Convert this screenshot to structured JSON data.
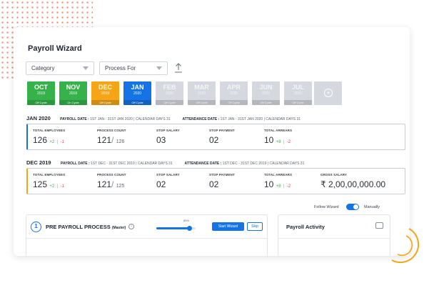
{
  "title": "Payroll Wizard",
  "filters": {
    "category": "Category",
    "process_for": "Process For"
  },
  "months": [
    {
      "name": "OCT",
      "year": "2019",
      "tag": "Off Cycle",
      "state": "green"
    },
    {
      "name": "NOV",
      "year": "2019",
      "tag": "On Cycle",
      "state": "green"
    },
    {
      "name": "DEC",
      "year": "2019",
      "tag": "Off Cycle",
      "state": "orange"
    },
    {
      "name": "JAN",
      "year": "2020",
      "tag": "Off Cycle",
      "state": "blue"
    },
    {
      "name": "FEB",
      "year": "2020",
      "tag": "Off Cycle",
      "state": "grey"
    },
    {
      "name": "MAR",
      "year": "2020",
      "tag": "Off Cycle",
      "state": "grey"
    },
    {
      "name": "APR",
      "year": "2020",
      "tag": "Off Cycle",
      "state": "grey"
    },
    {
      "name": "JUN",
      "year": "2020",
      "tag": "Off Cycle",
      "state": "grey"
    },
    {
      "name": "JUL",
      "year": "2020",
      "tag": "Off Cycle",
      "state": "grey"
    }
  ],
  "colors": {
    "green": "#36b24a",
    "orange": "#f5a516",
    "blue": "#1473e6",
    "grey": "#d5d8de"
  },
  "jan": {
    "month": "JAN 2020",
    "payroll_label": "PAYROLL DATE :",
    "payroll_value": "1ST JAN - 31ST JAN 2020 | CALENDAR DAYS 31",
    "attendance_label": "ATTENDANCE DATE :",
    "attendance_value": "1ST JAN - 31ST JAN 2020 | CALENDAR DAYS 31",
    "total_employees_label": "TOTAL EMPLOYEES",
    "total_employees": "126",
    "total_employees_plus": "+2",
    "total_employees_minus": "-1",
    "process_count_label": "PROCESS COUNT",
    "process_count": "121",
    "process_count_total": "126",
    "stop_salary_label": "STOP SALARY",
    "stop_salary": "03",
    "stop_payment_label": "STOP PAYMENT",
    "stop_payment": "02",
    "total_arrears_label": "TOTAL ARREARS",
    "total_arrears": "10",
    "total_arrears_plus": "+8",
    "total_arrears_minus": "-2"
  },
  "dec": {
    "month": "DEC 2019",
    "payroll_label": "PAYROLL DATE :",
    "payroll_value": "1ST DEC - 31ST DEC 2019 | CALENDAR DAYS 31",
    "attendance_label": "ATTENDANCE DATE :",
    "attendance_value": "1ST DEC - 31ST DEC 2019 | CALENDAR DAYS 31",
    "total_employees_label": "TOTAL EMPLOYEES",
    "total_employees": "125",
    "total_employees_plus": "+2",
    "total_employees_minus": "-1",
    "process_count_label": "PROCESS COUNT",
    "process_count": "121",
    "process_count_total": "125",
    "stop_salary_label": "STOP SALARY",
    "stop_salary": "02",
    "stop_payment_label": "STOP PAYMENT",
    "stop_payment": "02",
    "total_arrears_label": "TOTAL ARREARS",
    "total_arrears": "10",
    "total_arrears_plus": "+8",
    "total_arrears_minus": "-2",
    "gross_salary_label": "GROSS SALARY",
    "gross_salary": "₹ 2,00,00,000.00"
  },
  "wizard": {
    "follow": "Follow Wizard",
    "manual": "Manually",
    "manual_on": true
  },
  "pre_payroll": {
    "step": "1",
    "title": "PRE PAYROLL PROCESS",
    "sub": "(Master)",
    "progress_text": "85%",
    "progress": 0.85,
    "start_label": "Start Wizard",
    "skip_label": "Skip"
  },
  "activity": {
    "title": "Payroll Activity"
  }
}
